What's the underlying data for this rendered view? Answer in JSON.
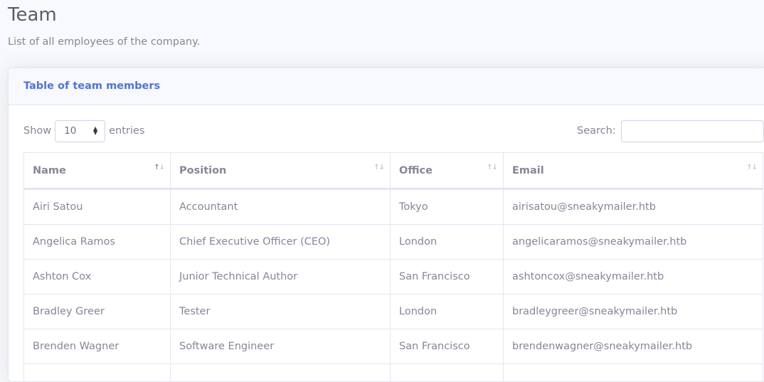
{
  "page": {
    "title": "Team",
    "subtitle": "List of all employees of the company."
  },
  "card": {
    "title": "Table of team members"
  },
  "controls": {
    "show_label": "Show",
    "entries_label": "entries",
    "length_value": "10",
    "search_label": "Search:",
    "search_value": ""
  },
  "table": {
    "columns": [
      "Name",
      "Position",
      "Office",
      "Email"
    ],
    "rows": [
      [
        "Airi Satou",
        "Accountant",
        "Tokyo",
        "airisatou@sneakymailer.htb"
      ],
      [
        "Angelica Ramos",
        "Chief Executive Officer (CEO)",
        "London",
        "angelicaramos@sneakymailer.htb"
      ],
      [
        "Ashton Cox",
        "Junior Technical Author",
        "San Francisco",
        "ashtoncox@sneakymailer.htb"
      ],
      [
        "Bradley Greer",
        "Tester",
        "London",
        "bradleygreer@sneakymailer.htb"
      ],
      [
        "Brenden Wagner",
        "Software Engineer",
        "San Francisco",
        "brendenwagner@sneakymailer.htb"
      ],
      [
        "",
        "",
        "",
        ""
      ]
    ]
  },
  "icons": {
    "sort": "sort-arrows-icon",
    "select": "select-updown-icon"
  },
  "colors": {
    "accent": "#4e73df",
    "text": "#858796",
    "heading": "#5a5c69",
    "border": "#e3e6f0",
    "background": "#f8f9fc"
  }
}
